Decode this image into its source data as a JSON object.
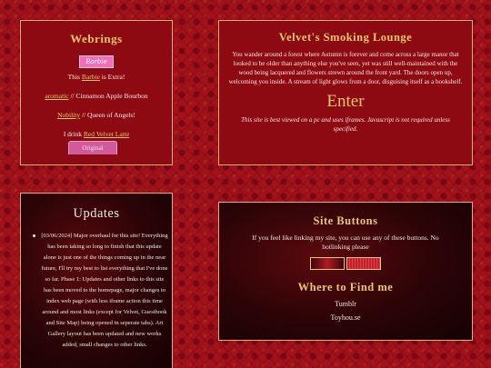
{
  "webrings": {
    "title": "Webrings",
    "barbie_button_text": "Barbie",
    "line1": {
      "prefix": "This ",
      "link": "Barbie",
      "suffix": " is Extra!"
    },
    "line2": {
      "link": "aromatic",
      "suffix": " // Cinnamon Apple Bourbon"
    },
    "line3": {
      "link": "Nobility",
      "suffix": " // Queen of Angels!"
    },
    "line4": {
      "prefix": "I drink ",
      "link": "Red Velvet Latte"
    },
    "original_button": "Original"
  },
  "lounge": {
    "title": "Velvet's Smoking Lounge",
    "story": "You wander around a forest where Autumn is forever and come across a large manor that looked to be older than anything else you've seen, yet was still well-maintained with the wood being lacquered and flowers strewn around the front yard. The doors open up, welcoming you inside. A stream of light glows from a door, disguising itself as a bookshelf.",
    "enter": "Enter",
    "note": "This site is best viewed on a pc and uses iframes. Javascript is not required unless specified."
  },
  "updates": {
    "title": "Updates",
    "text": "[03/06/2024] Major overhaul for this site! Everything has been taking so long to finish that this update alone is just one of the things coming up in the near future, I'll try my best to list everything that I've done so far. Phase 1: Updates and other links to this site has been moved to the homepage, major changes to index web page (with less iframe action this time around and most links (except for Velvet, Guestbook and Site Map) being opened in seperate tabs). Art Gallery layout has been updated and new works added, small changes to other links."
  },
  "site_buttons": {
    "title": "Site Buttons",
    "description": "If you feel like linking my site, you can use any of these buttons. No hotlinking please",
    "where_title": "Where to Find me",
    "links": [
      "Tumblr",
      "Toyhou.se"
    ]
  },
  "colors": {
    "background": "#a3121a",
    "panel_red": "#8e0a12",
    "gold": "#e8c86a",
    "border": "#d9b07a",
    "original_button": "#d15a9a"
  }
}
